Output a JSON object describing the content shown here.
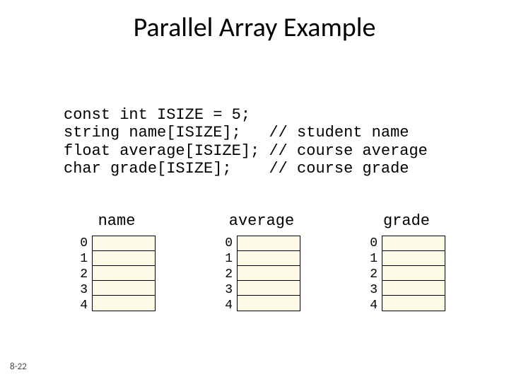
{
  "title": "Parallel Array Example",
  "code": {
    "line1": "const int ISIZE = 5;",
    "line2": "string name[ISIZE];   // student name",
    "line3": "float average[ISIZE]; // course average",
    "line4": "char grade[ISIZE];    // course grade"
  },
  "arrays": [
    {
      "header": "name",
      "indices": [
        "0",
        "1",
        "2",
        "3",
        "4"
      ]
    },
    {
      "header": "average",
      "indices": [
        "0",
        "1",
        "2",
        "3",
        "4"
      ]
    },
    {
      "header": "grade",
      "indices": [
        "0",
        "1",
        "2",
        "3",
        "4"
      ]
    }
  ],
  "footer": "8-22"
}
